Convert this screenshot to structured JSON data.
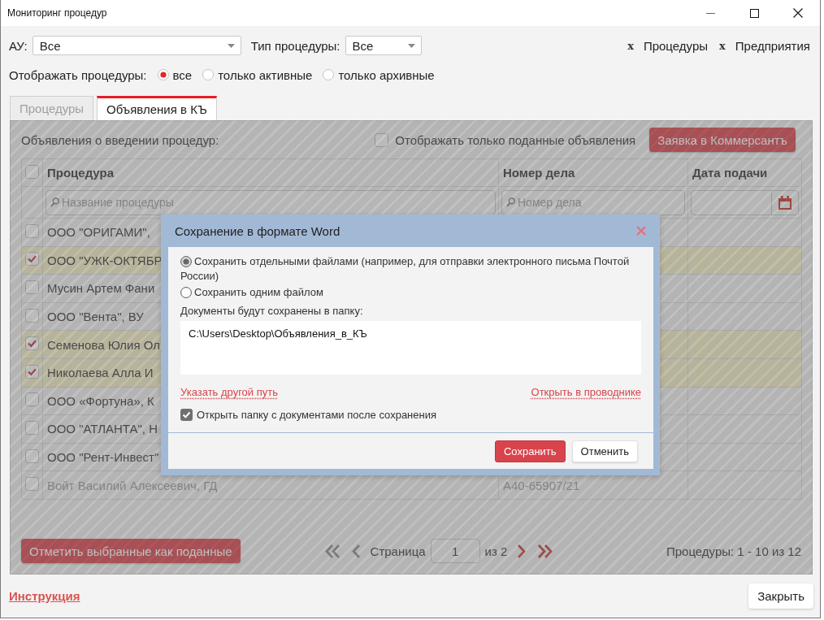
{
  "window": {
    "title": "Мониторинг процедур"
  },
  "filters": [
    {
      "label": "АУ:",
      "value": "Все"
    },
    {
      "label": "Тип процедуры:",
      "value": "Все"
    }
  ],
  "tags": [
    {
      "remove": "x",
      "label": "Процедуры"
    },
    {
      "remove": "x",
      "label": "Предприятия"
    }
  ],
  "display": {
    "label": "Отображать процедуры:",
    "options": [
      {
        "label": "все",
        "selected": true
      },
      {
        "label": "только активные",
        "selected": false
      },
      {
        "label": "только архивные",
        "selected": false
      }
    ]
  },
  "tabs": [
    {
      "label": "Процедуры",
      "selected": false
    },
    {
      "label": "Объявления в КЪ",
      "selected": true
    }
  ],
  "panel": {
    "heading": "Объявления о введении процедур:",
    "only_submitted": {
      "label": "Отображать только поданные объявления",
      "checked": false
    },
    "request_button": "Заявка в Коммерсантъ"
  },
  "table": {
    "select_all": {
      "checked": false
    },
    "columns": [
      {
        "label": "Процедура",
        "filter": {
          "kind": "search",
          "placeholder": "Название процедуры"
        }
      },
      {
        "label": "Номер дела",
        "filter": {
          "kind": "search",
          "placeholder": "Номер дела"
        }
      },
      {
        "label": "Дата подачи",
        "filter": {
          "kind": "date"
        }
      }
    ],
    "rows": [
      {
        "checked": false,
        "disabled": false,
        "procedure": "ООО \"ОРИГАМИ\","
      },
      {
        "checked": true,
        "disabled": false,
        "procedure": "ООО \"УЖК-ОКТЯБР"
      },
      {
        "checked": false,
        "disabled": false,
        "procedure": "Мусин Артем Фани"
      },
      {
        "checked": false,
        "disabled": false,
        "procedure": "ООО \"Вента\", ВУ"
      },
      {
        "checked": true,
        "disabled": false,
        "procedure": "Семенова Юлия Ол"
      },
      {
        "checked": true,
        "disabled": false,
        "procedure": "Николаева Алла И"
      },
      {
        "checked": false,
        "disabled": false,
        "procedure": "ООО «Фортуна», К"
      },
      {
        "checked": false,
        "disabled": false,
        "procedure": "ООО \"АТЛАНТА\", Н"
      },
      {
        "checked": false,
        "disabled": false,
        "procedure": "ООО \"Рент-Инвест\""
      },
      {
        "checked": false,
        "disabled": true,
        "procedure": "Войт Василий Алексеевич, ГД",
        "case_number": "А40-65907/21"
      }
    ]
  },
  "mark_button": "Отметить выбранные как поданные",
  "pagination": {
    "nav": [
      {
        "kind": "first",
        "disabled": true
      },
      {
        "kind": "prev",
        "disabled": true
      },
      {
        "kind": "next",
        "disabled": false
      },
      {
        "kind": "last",
        "disabled": false
      }
    ],
    "page_label": "Страница",
    "page": "1",
    "total": "из 2",
    "summary": "Процедуры: 1 - 10 из 12"
  },
  "footer": {
    "help_link": "Инструкция",
    "close_button": "Закрыть"
  },
  "dialog": {
    "title": "Сохранение в формате Word",
    "options": [
      {
        "label": "Сохранить отдельными файлами (например, для отправки электронного письма Почтой России)",
        "selected": true
      },
      {
        "label": "Сохранить одним файлом",
        "selected": false
      }
    ],
    "folder_label": "Документы будут сохранены в папку:",
    "folder_path": "C:\\Users\\Desktop\\Объявления_в_КЪ",
    "links": [
      "Указать другой путь",
      "Открыть в проводнике"
    ],
    "open_folder": {
      "label": "Открыть папку с документами после сохранения",
      "checked": true
    },
    "buttons": [
      {
        "label": "Сохранить",
        "kind": "primary"
      },
      {
        "label": "Отменить",
        "kind": "secondary"
      }
    ]
  }
}
